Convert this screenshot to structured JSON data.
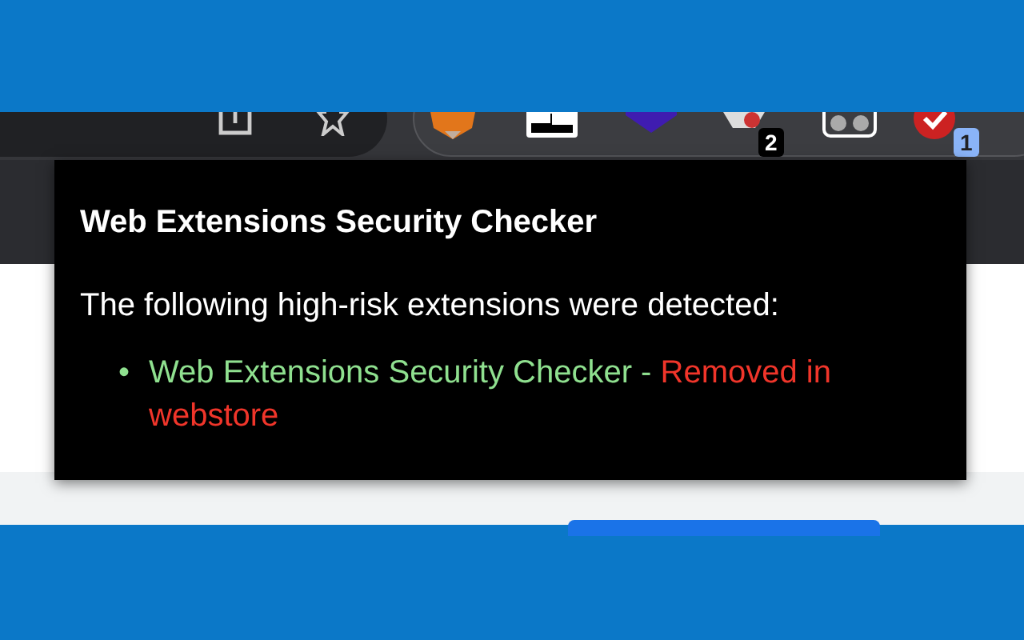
{
  "toolbar": {
    "badges": [
      {
        "text": "2",
        "color": "#000000"
      },
      {
        "text": "1",
        "color": "#8ab4f8"
      }
    ]
  },
  "popup": {
    "title": "Web Extensions Security Checker",
    "message": "The following high-risk extensions were detected:",
    "items": [
      {
        "bullet": "•",
        "name": "Web Extensions Security Checker -",
        "status": "Removed in webstore"
      }
    ]
  }
}
